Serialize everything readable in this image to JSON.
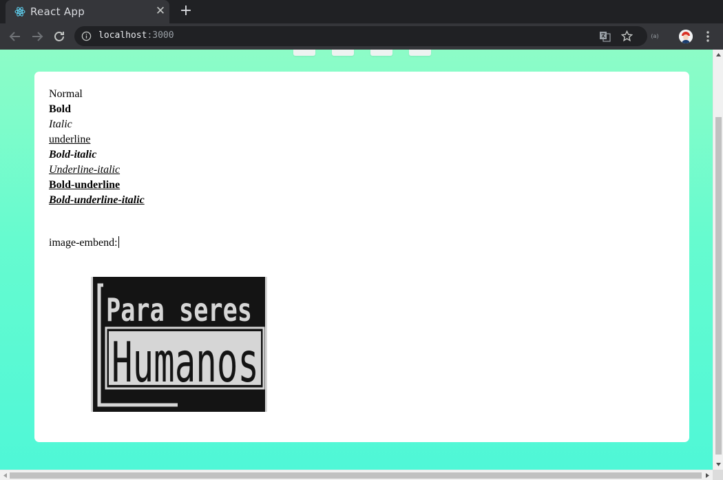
{
  "browser": {
    "tab_title": "React App",
    "tab_close_glyph": "✕",
    "new_tab_glyph": "+",
    "url_host": "localhost",
    "url_port": ":3000",
    "icons": {
      "favicon": "react-logo-icon",
      "back": "back-arrow-icon",
      "forward": "forward-arrow-icon",
      "reload": "reload-icon",
      "site_info": "info-icon",
      "translate": "translate-icon",
      "bookmark": "star-icon",
      "extension": "extension-icon",
      "profile": "avatar",
      "menu": "kebab-menu-icon"
    },
    "extension_label": "(a)"
  },
  "page": {
    "colors": {
      "gradient_top": "#8dfcc7",
      "gradient_bottom": "#4ff7d7",
      "card": "#ffffff"
    },
    "editor": {
      "lines": {
        "normal": "Normal",
        "bold": "Bold",
        "italic": "Italic",
        "underline": "underline",
        "bold_italic": "Bold-italic",
        "underline_italic": "Underline-italic",
        "bold_underline": "Bold-underline",
        "bold_underline_italic": "Bold-underline-italic"
      },
      "embed_label": "image-embend:",
      "embedded_image": {
        "line1": "Para seres",
        "line2": "Humanos"
      }
    }
  }
}
